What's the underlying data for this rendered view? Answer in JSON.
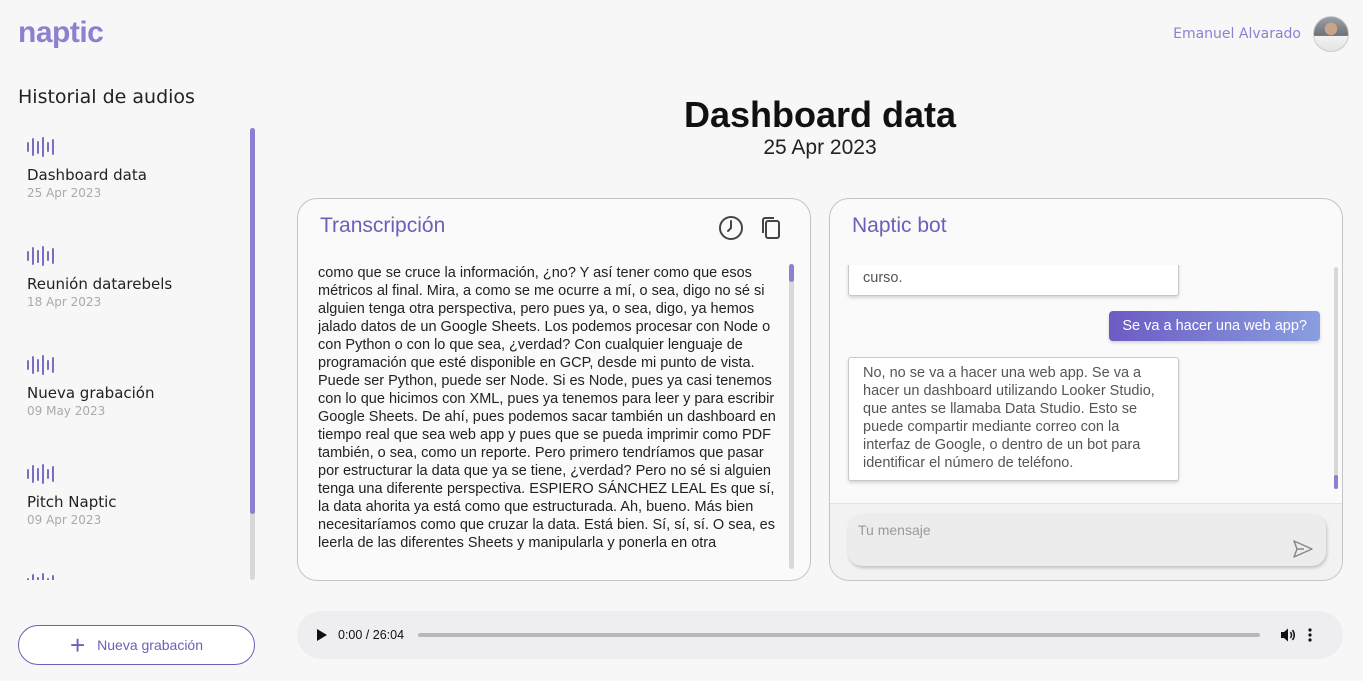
{
  "app": {
    "logo": "naptic"
  },
  "user": {
    "name": "Emanuel Alvarado"
  },
  "sidebar": {
    "title": "Historial de audios",
    "items": [
      {
        "title": "Dashboard data",
        "date": "25 Apr 2023"
      },
      {
        "title": "Reunión datarebels",
        "date": "18 Apr 2023"
      },
      {
        "title": "Nueva grabación",
        "date": "09 May 2023"
      },
      {
        "title": "Pitch Naptic",
        "date": "09 Apr 2023"
      },
      {
        "title": "",
        "date": ""
      }
    ],
    "new_button": "Nueva grabación"
  },
  "main": {
    "title": "Dashboard data",
    "date": "25 Apr 2023"
  },
  "transcript": {
    "title": "Transcripción",
    "text": "como que se cruce la información, ¿no? Y así tener como que esos métricos al final. Mira, a como se me ocurre a mí, o sea, digo no sé si alguien tenga otra perspectiva, pero pues ya, o sea, digo, ya hemos jalado datos de un Google Sheets. Los podemos procesar con Node o con Python o con lo que sea, ¿verdad? Con cualquier lenguaje de programación que esté disponible en GCP, desde mi punto de vista. Puede ser Python, puede ser Node. Si es Node, pues ya casi tenemos con lo que hicimos con XML, pues ya tenemos para leer y para escribir Google Sheets. De ahí, pues podemos sacar también un dashboard en tiempo real que sea web app y pues que se pueda imprimir como PDF también, o sea, como un reporte. Pero primero tendríamos que pasar por estructurar la data que ya se tiene, ¿verdad? Pero no sé si alguien tenga una diferente perspectiva. ESPIERO SÁNCHEZ LEAL Es que sí, la data ahorita ya está como que estructurada. Ah, bueno. Más bien necesitaríamos como que cruzar la data. Está bien. Sí, sí, sí. O sea, es leerla de las diferentes Sheets y manipularla y ponerla en otra"
  },
  "chat": {
    "title": "Naptic bot",
    "messages": [
      {
        "role": "bot",
        "text": "curso."
      },
      {
        "role": "user",
        "text": "Se va a hacer una web app?"
      },
      {
        "role": "bot",
        "text": "No, no se va a hacer una web app. Se va a hacer un dashboard utilizando Looker Studio, que antes se llamaba Data Studio. Esto se puede compartir mediante correo con la interfaz de Google, o dentro de un bot para identificar el número de teléfono."
      }
    ],
    "input_placeholder": "Tu mensaje"
  },
  "audio": {
    "time": "0:00 / 26:04",
    "progress": 0
  },
  "colors": {
    "accent": "#6d5fb8",
    "logo": "#8e80d0"
  }
}
